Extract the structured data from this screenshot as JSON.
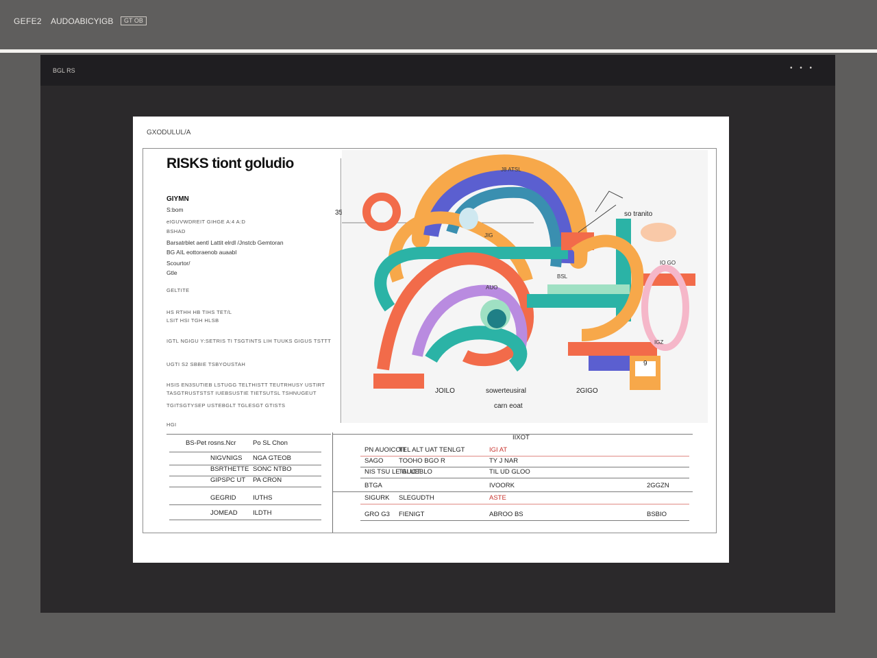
{
  "app": {
    "name": "GEFE2",
    "file_name": "AUDOABICYIGB",
    "badge": "GT OB"
  },
  "viewer": {
    "title": "BGL RS",
    "dots": "• • •"
  },
  "document": {
    "label": "GXODULUL/A",
    "title": "RISKS tiont goludio",
    "left_lines": [
      {
        "text": "GIYMN",
        "style": "b"
      },
      {
        "text": "S:bom",
        "style": ""
      },
      {
        "text": "eIGUVWDREIT GIHGE        A:4 A:D",
        "style": "s"
      },
      {
        "text": "BSHAD",
        "style": "s"
      },
      {
        "text": "Barsatrblet aentl Lattit elrdl /Jnstcb Gemtoran",
        "style": ""
      },
      {
        "text": "BG AIL eottoraenob auaabl",
        "style": ""
      },
      {
        "text": "Scourtor/",
        "style": ""
      },
      {
        "text": "Gtle",
        "style": ""
      },
      {
        "text": "GELTITE",
        "style": "s"
      },
      {
        "text": "HS RTHH  HB TIHS   TET/L",
        "style": "s"
      },
      {
        "text": "LSIT                     HSI TGH   HLSB",
        "style": "s"
      },
      {
        "text": "IGTL NGIGU Y:SETRIS TI TSGTINTS LIH TUUKS GIGUS TSTTT",
        "style": "s"
      },
      {
        "text": "UGTI S2 SBBIE        TSBYOUSTAH",
        "style": "s"
      },
      {
        "text": "HSIS EN3SUTIEB LSTUGG TELTHISTT TEUTRHUSY USTIRT",
        "style": "s"
      },
      {
        "text": "TASGTRUSTSTST IUEBSUSTIE TIETSUTSL TSHNUGEUT",
        "style": "s"
      },
      {
        "text": "TGITSGTYSEP USTEBGLT TGLESGT GTISTS",
        "style": "s"
      },
      {
        "text": "HGI",
        "style": "s"
      }
    ],
    "side_label": "35",
    "chart_labels": {
      "top_arc": "J8 ATSL",
      "callout": "so tranito",
      "mid": "JIG",
      "center": "AUO",
      "right_small": "IO GO",
      "right_side": "IGZ",
      "right_num": "9",
      "teal_label": "BSL",
      "axis_left": "JOILO",
      "axis_center": "sowerteusiral",
      "axis_right": "2GIGO",
      "axis_title": "carn eoat"
    },
    "table_left": {
      "header": [
        "BS-Pet  rosns.Ncr",
        "Po SL Chon"
      ],
      "rows": [
        {
          "a": "NIGVNIGS",
          "b": "NGA GTEOB"
        },
        {
          "a": "BSRTHETTE",
          "b": "SONC NTBO"
        },
        {
          "a": "GIPSPC UT",
          "b": "PA  CRON"
        },
        {
          "a": "GEGRID",
          "b": "IUTHS"
        },
        {
          "a": "JOMEAD",
          "b": "ILDTH"
        }
      ]
    },
    "table_right": {
      "header": "IIXOT",
      "rows": [
        {
          "a": "PN AUOICOIT",
          "b": "TEL ALT UAT TENLGT",
          "c": "IGI AT",
          "red": true
        },
        {
          "a": "SAGO",
          "b": "TOOHO BGO R",
          "c": "TY J NAR",
          "red": false
        },
        {
          "a": "NIS TSU LE GUOT",
          "b": "TAI UEBLO",
          "c": "TIL UD GLOO",
          "red": false
        },
        {
          "a": "BTGA",
          "b": "",
          "c": "IVOORK",
          "d": "2GGZN",
          "red": false
        },
        {
          "a": "SIGURK",
          "b": "SLEGUDTH",
          "c": "ASTE",
          "red": true
        },
        {
          "a": "GRO G3",
          "b": "FIENIGT",
          "c": "ABROO BS",
          "d": "BSBIO",
          "red": false
        }
      ]
    }
  },
  "chart_data": {
    "type": "diagram",
    "palette": [
      "#f26b4a",
      "#f7a84a",
      "#5b5fd0",
      "#2bb3a6",
      "#b98be0",
      "#9fe0c3",
      "#f5b7c9",
      "#3a8fb0"
    ]
  }
}
